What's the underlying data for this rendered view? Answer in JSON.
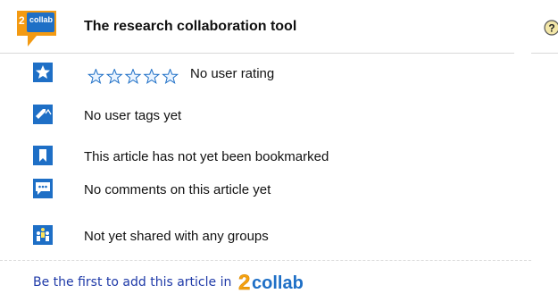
{
  "header": {
    "logo_text": "collab",
    "logo_number": "2",
    "title": "The research collaboration tool"
  },
  "rows": [
    {
      "icon": "star-icon",
      "text": "No user rating",
      "stars_filled": 0,
      "stars_total": 5
    },
    {
      "icon": "tag-icon",
      "text": "No user tags yet"
    },
    {
      "icon": "bookmark-icon",
      "text": "This article has not yet been bookmarked"
    },
    {
      "icon": "comment-icon",
      "text": "No comments on this article yet"
    },
    {
      "icon": "group-icon",
      "text": "Not yet shared with any groups"
    }
  ],
  "cta": {
    "text": "Be the first to add this article in",
    "logo_number": "2",
    "logo_text": "collab"
  },
  "colors": {
    "brand_blue": "#1e6fc6",
    "logo_orange": "#f39a12",
    "cta_text": "#1f3aa8"
  }
}
